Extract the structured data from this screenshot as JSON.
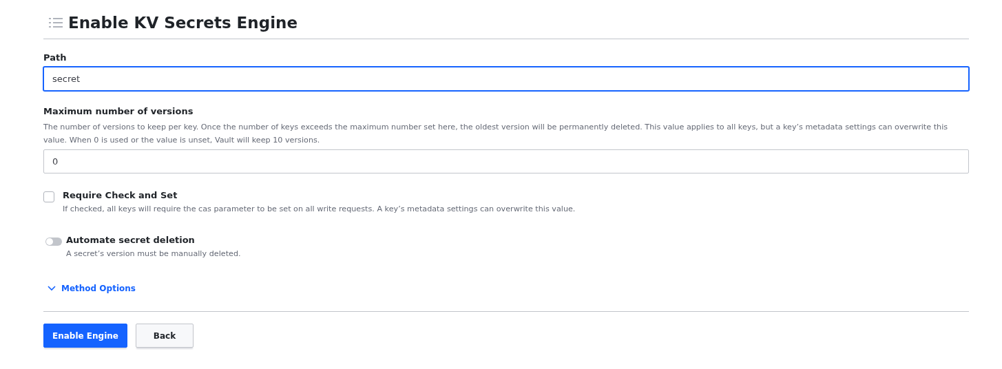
{
  "title": "Enable KV Secrets Engine",
  "path": {
    "label": "Path",
    "value": "secret",
    "focused": true
  },
  "max_versions": {
    "label": "Maximum number of versions",
    "help": "The number of versions to keep per key. Once the number of keys exceeds the maximum number set here, the oldest version will be permanently deleted. This value applies to all keys, but a key’s metadata settings can overwrite this value. When 0 is used or the value is unset, Vault will keep 10 versions.",
    "value": "0"
  },
  "cas": {
    "label": "Require Check and Set",
    "help": "If checked, all keys will require the cas parameter to be set on all write requests. A key’s metadata settings can overwrite this value.",
    "checked": false
  },
  "auto_delete": {
    "label": "Automate secret deletion",
    "help": "A secret’s version must be manually deleted.",
    "on": false
  },
  "method_options": {
    "label": "Method Options",
    "expanded": false
  },
  "buttons": [
    {
      "label": "Enable Engine",
      "kind": "primary"
    },
    {
      "label": "Back",
      "kind": "secondary"
    }
  ]
}
